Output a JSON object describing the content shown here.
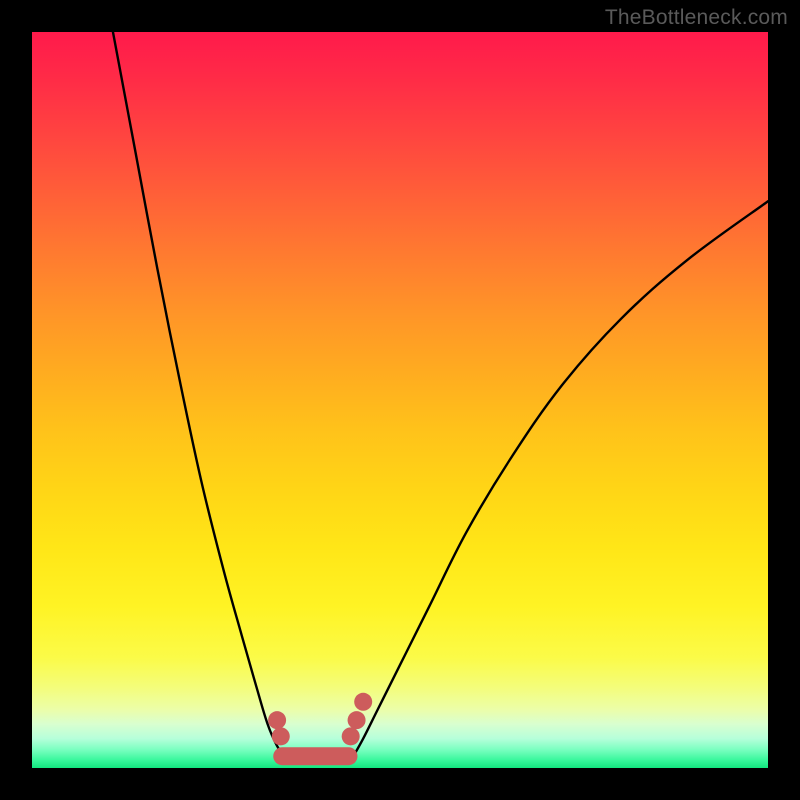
{
  "watermark": "TheBottleneck.com",
  "chart_data": {
    "type": "line",
    "title": "",
    "xlabel": "",
    "ylabel": "",
    "xlim": [
      0,
      100
    ],
    "ylim": [
      0,
      100
    ],
    "grid": false,
    "series": [
      {
        "name": "left-branch",
        "x": [
          11,
          14,
          17,
          20,
          23,
          26,
          28.5,
          30.5,
          32,
          33.3,
          34.4
        ],
        "y": [
          100,
          84,
          68,
          53,
          39,
          27,
          18,
          11,
          6,
          3,
          1.5
        ]
      },
      {
        "name": "right-branch",
        "x": [
          43.6,
          45,
          47,
          50,
          54,
          59,
          65,
          72,
          80,
          89,
          100
        ],
        "y": [
          1.5,
          4,
          8,
          14,
          22,
          32,
          42,
          52,
          61,
          69,
          77
        ]
      }
    ],
    "markers": {
      "name": "highlight-dots",
      "color": "#cd5c5c",
      "points": [
        {
          "x": 33.3,
          "y": 6.5
        },
        {
          "x": 33.8,
          "y": 4.3
        },
        {
          "x": 43.3,
          "y": 4.3
        },
        {
          "x": 44.1,
          "y": 6.5
        },
        {
          "x": 45.0,
          "y": 9.0
        }
      ]
    },
    "bottom_band": {
      "name": "bottom-connector",
      "color": "#cd5c5c",
      "x_start": 34.0,
      "x_end": 43.0,
      "y": 1.6
    },
    "background_gradient": {
      "top_color": "#ff1a4b",
      "mid_color": "#ffe617",
      "bottom_color": "#13E67F"
    }
  }
}
